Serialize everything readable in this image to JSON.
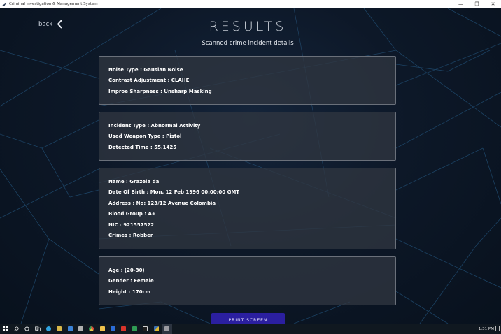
{
  "window": {
    "title": "Criminal Investigation & Management System",
    "controls": {
      "minimize": "—",
      "restore": "❐",
      "close": "✕"
    }
  },
  "page": {
    "back_label": "back",
    "title": "RESULTS",
    "subtitle": "Scanned crime incident details"
  },
  "cards": [
    {
      "lines": [
        "Noise Type : Gausian Noise",
        "Contrast Adjustment : CLAHE",
        "Improe Sharpness : Unsharp Masking"
      ]
    },
    {
      "lines": [
        "Incident Type : Abnormal Activity",
        "Used Weapon Type : Pistol",
        "Detected Time : 55.1425"
      ]
    },
    {
      "lines": [
        "Name : Grazela da",
        "Date Of Birth : Mon, 12 Feb 1996 00:00:00 GMT",
        "Address : No: 123/12 Avenue Colombia",
        "Blood Group : A+",
        "NIC : 921557522",
        "Crimes : Robber"
      ]
    },
    {
      "lines": [
        "Age : (20-30)",
        "Gender : Female",
        "Height : 170cm"
      ]
    }
  ],
  "print_button": "PRINT SCREEN",
  "taskbar": {
    "icons": [
      {
        "name": "start-icon",
        "color": "#ffffff"
      },
      {
        "name": "search-icon",
        "color": "#ffffff"
      },
      {
        "name": "cortana-icon",
        "color": "#ffffff"
      },
      {
        "name": "task-view-icon",
        "color": "#ffffff"
      },
      {
        "name": "edge-icon",
        "color": "#2fa3e0"
      },
      {
        "name": "store-icon",
        "color": "#d9b84a"
      },
      {
        "name": "mail-icon",
        "color": "#3b82d6"
      },
      {
        "name": "lock-icon",
        "color": "#b0b0b0"
      },
      {
        "name": "chrome-icon",
        "color": "#e6c84a"
      },
      {
        "name": "explorer-icon",
        "color": "#f0c24b"
      },
      {
        "name": "word-icon",
        "color": "#2b6cd6"
      },
      {
        "name": "acrobat-icon",
        "color": "#d9342b"
      },
      {
        "name": "excel-icon",
        "color": "#2f9c55"
      },
      {
        "name": "terminal-icon",
        "color": "#d0d0d0"
      },
      {
        "name": "python-icon",
        "color": "#e0b830"
      },
      {
        "name": "app-window-icon",
        "color": "#9a9aa0"
      }
    ],
    "clock": "1:31 PM"
  }
}
